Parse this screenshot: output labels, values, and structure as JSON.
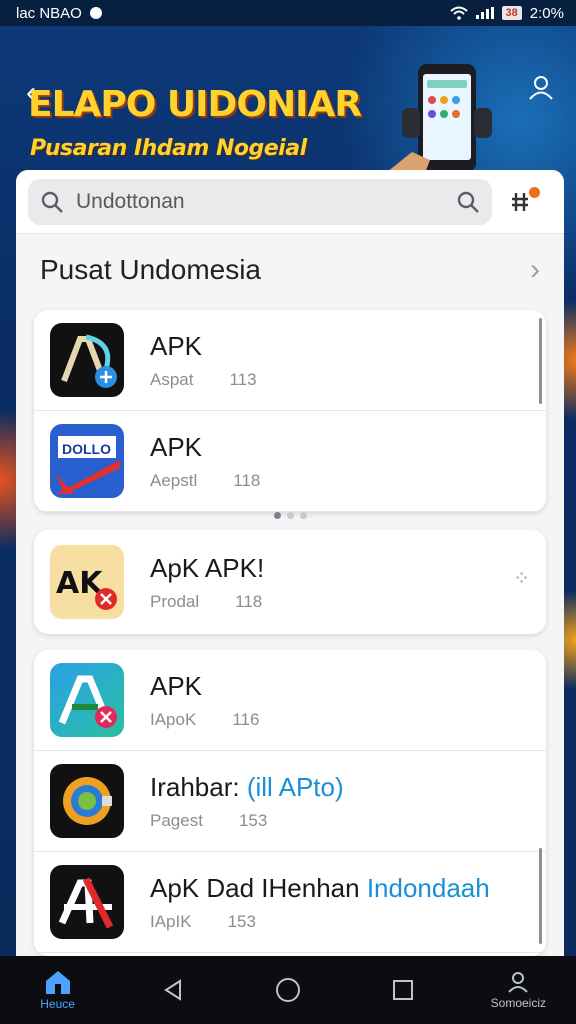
{
  "status_bar": {
    "left_text": "lac NBAO",
    "battery": "38",
    "time": "2:0%"
  },
  "banner": {
    "title": "ELAPO UIDONIAR",
    "subtitle": "Pusaran Ihdam Nogeial"
  },
  "search": {
    "placeholder": "Undottonan"
  },
  "section": {
    "title": "Pusat Undomesia"
  },
  "card1": [
    {
      "name": "APK",
      "meta1": "Aspat",
      "meta2": "113",
      "icon": "ap-dark-icon"
    },
    {
      "name": "APK",
      "meta1": "Aepstl",
      "meta2": "118",
      "icon": "blue-red-app-icon"
    }
  ],
  "card2": [
    {
      "name": "ApK APK!",
      "meta1": "Prodal",
      "meta2": "118",
      "icon": "apk-beige-icon"
    }
  ],
  "card3": [
    {
      "name": "APK",
      "meta1": "IApoK",
      "meta2": "116",
      "icon": "ap-green-icon"
    },
    {
      "name": "Irahbar:",
      "name_highlight": "(ill APto)",
      "meta1": "Pagest",
      "meta2": "153",
      "icon": "circle-logo-icon"
    },
    {
      "name": "ApK Dad IHenhan",
      "name_highlight": "Indondaah",
      "meta1": "IApIK",
      "meta2": "153",
      "icon": "ap-red-black-icon"
    }
  ],
  "nav": {
    "home_label": "Heuce",
    "profile_label": "Somoeiciz"
  },
  "colors": {
    "accent": "#4ba3ff",
    "banner_title": "#ffd22e",
    "highlight": "#1a8fd8"
  }
}
